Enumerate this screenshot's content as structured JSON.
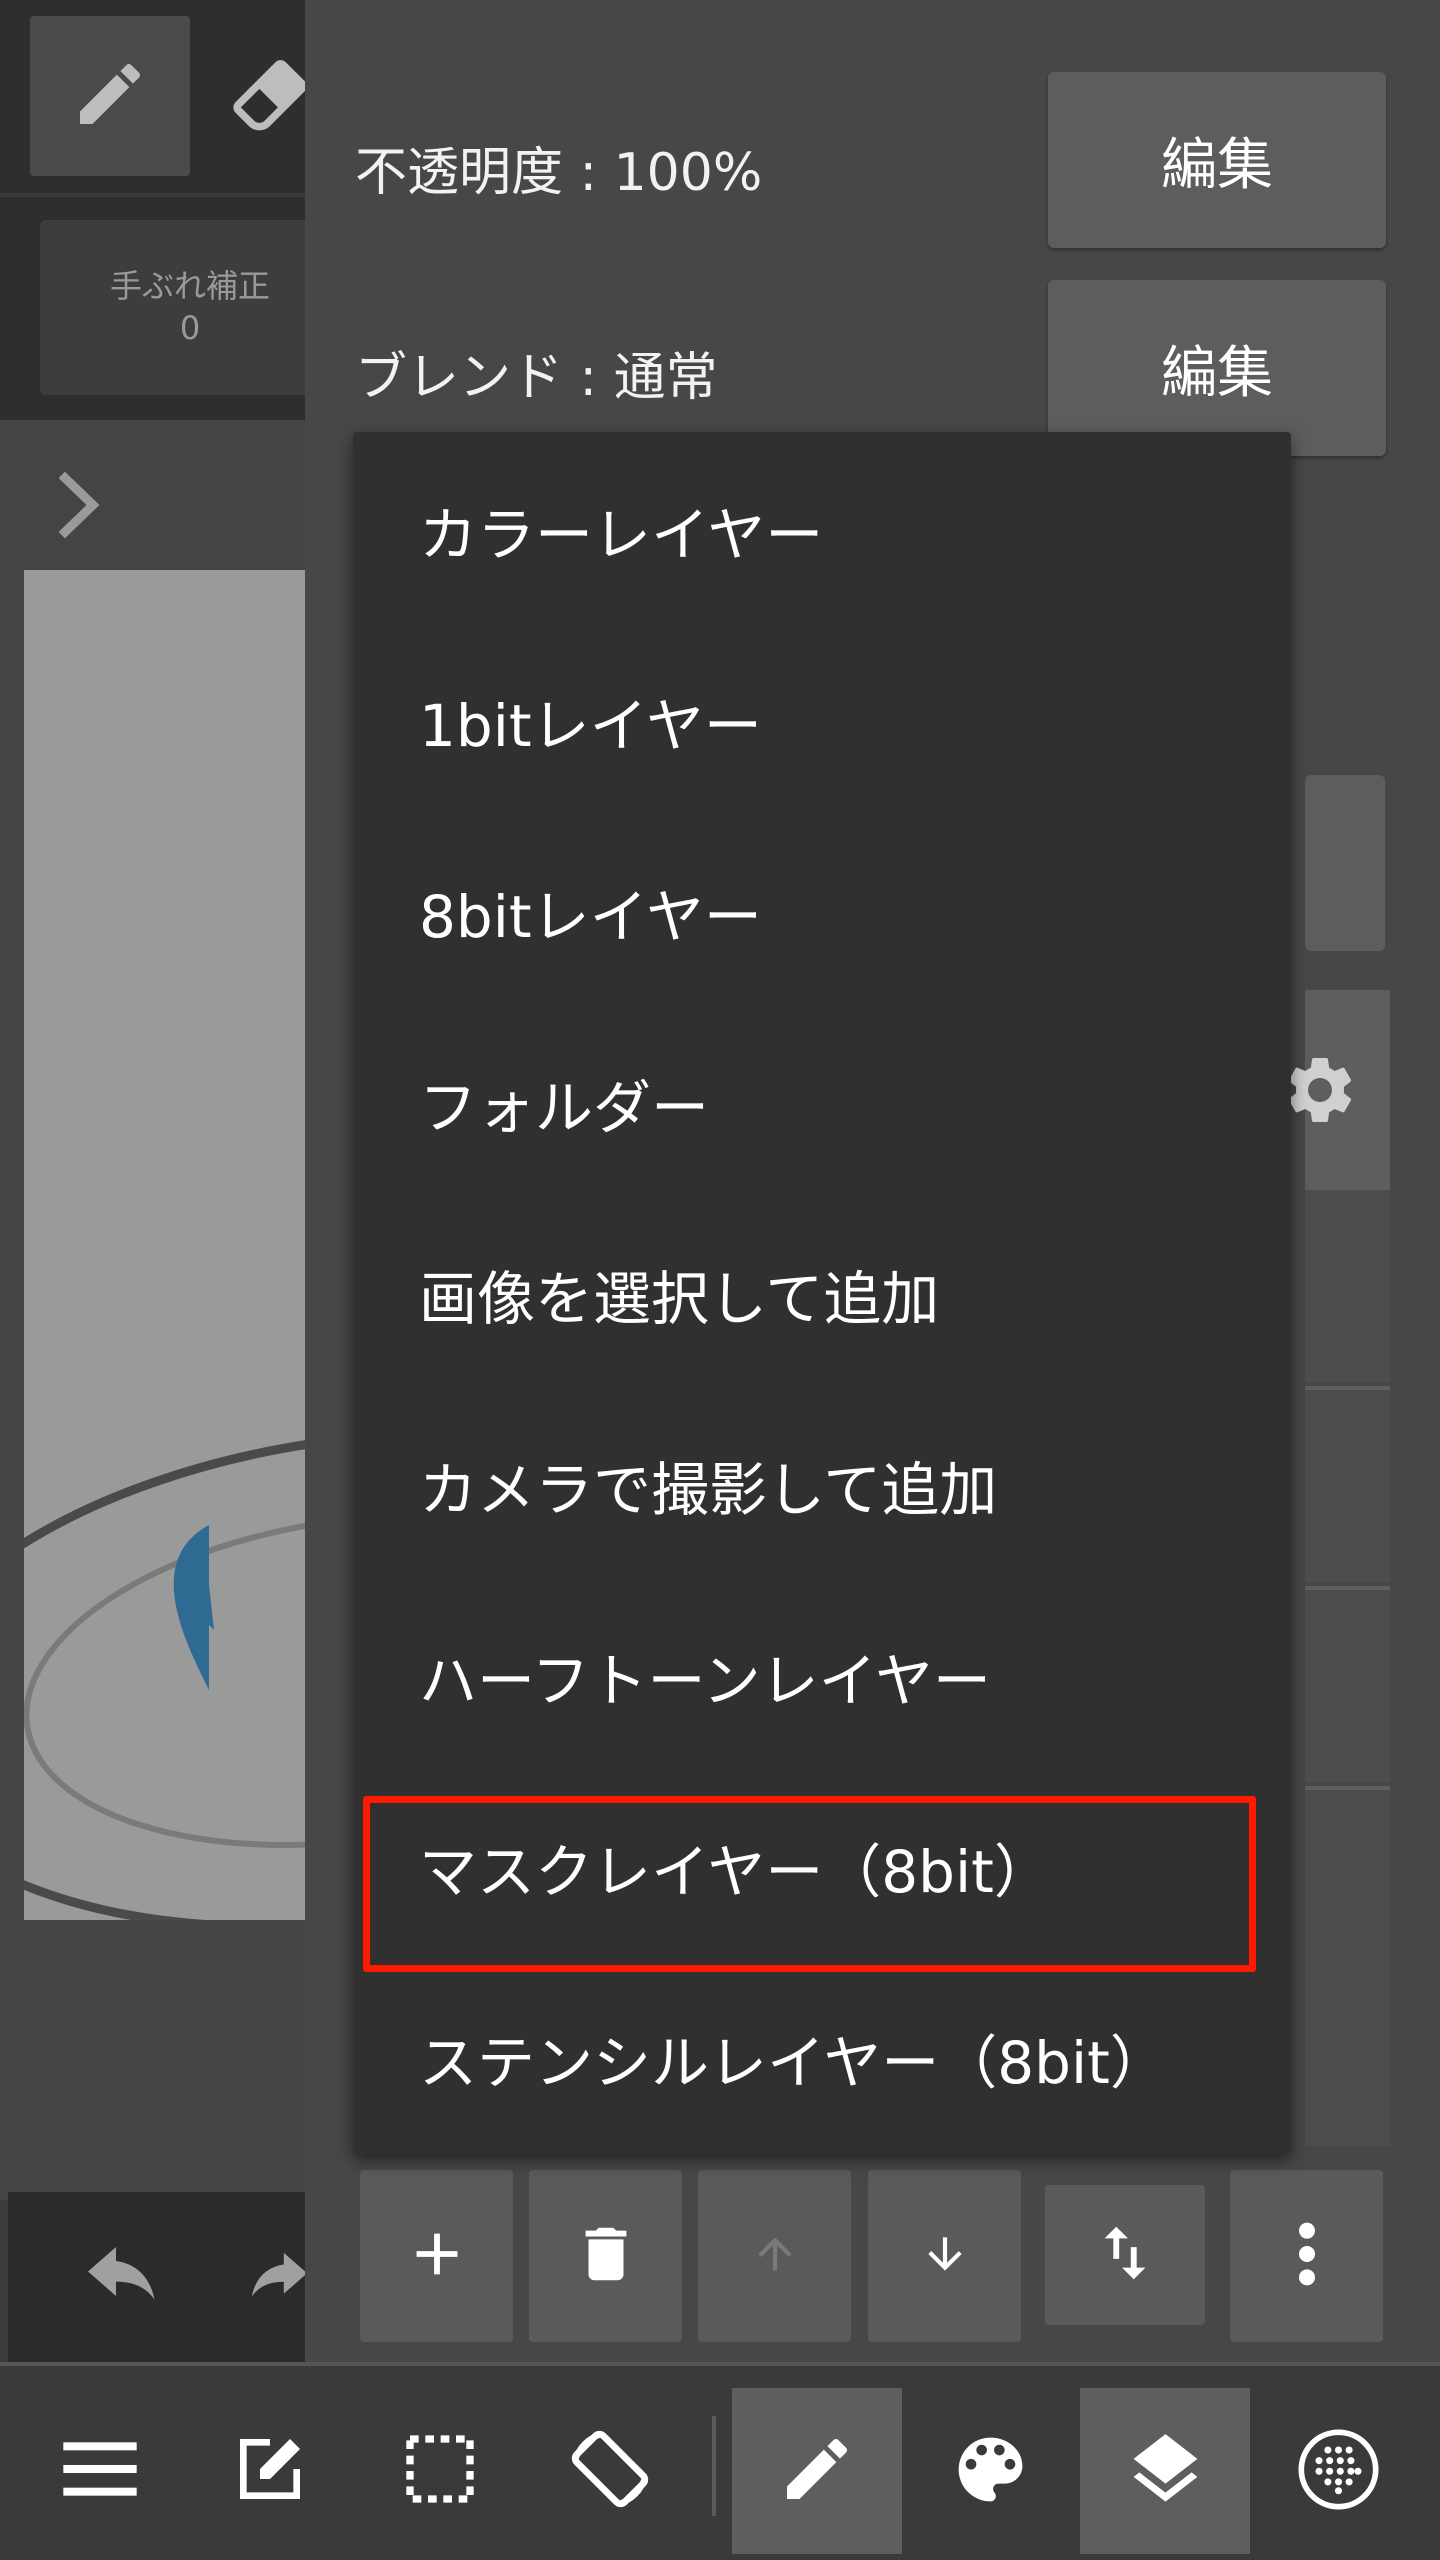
{
  "colors": {
    "panel_bg": "#474747",
    "dropdown_bg": "#303030",
    "highlight_border": "#ff1a00",
    "button_bg": "#5d5d5d"
  },
  "left_toolbar": {
    "stabilizer_label": "手ぶれ補正",
    "stabilizer_value": "0",
    "tools": [
      "pencil-icon",
      "eraser-icon"
    ]
  },
  "layer_props": {
    "opacity_label": "不透明度 : 100%",
    "opacity_edit": "編集",
    "blend_label": "ブレンド : 通常",
    "blend_edit": "編集"
  },
  "add_layer_menu": {
    "items": [
      "カラーレイヤー",
      "1bitレイヤー",
      "8bitレイヤー",
      "フォルダー",
      "画像を選択して追加",
      "カメラで撮影して追加",
      "ハーフトーンレイヤー",
      "マスクレイヤー（8bit）",
      "ステンシルレイヤー（8bit）"
    ],
    "highlighted_item": "マスクレイヤー（8bit）"
  },
  "layer_actions": [
    "add-icon",
    "trash-icon",
    "move-up-icon",
    "move-down-icon",
    "swap-icon",
    "more-vert-icon"
  ],
  "bottom_bar": [
    "menu-icon",
    "edit-note-icon",
    "selection-icon",
    "rotate-icon",
    "pencil-icon",
    "palette-icon",
    "layers-icon",
    "dots-grid-icon"
  ]
}
